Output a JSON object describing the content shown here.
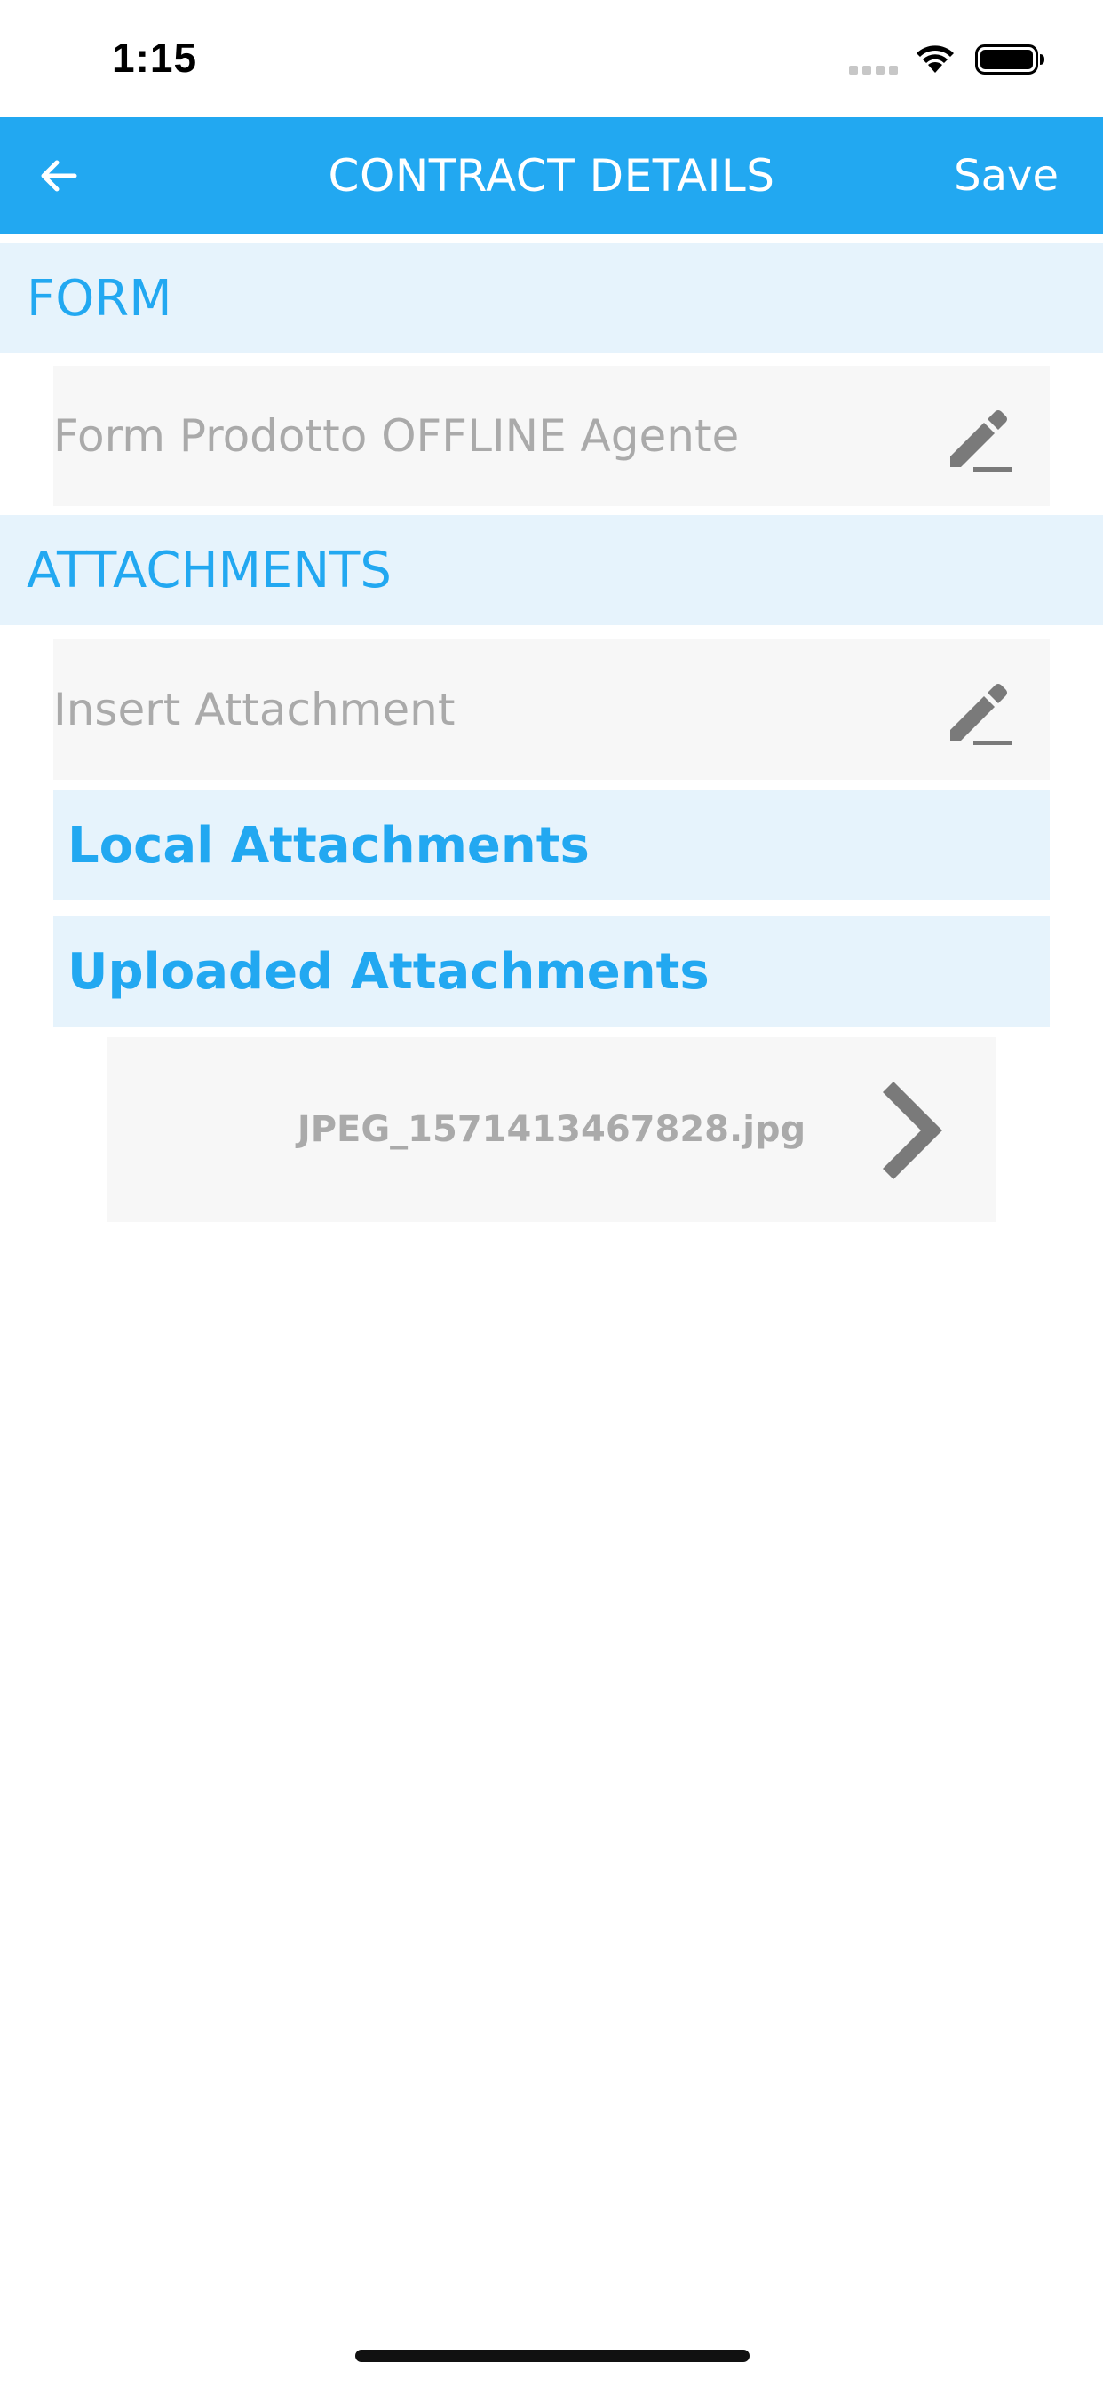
{
  "status_bar": {
    "time": "1:15"
  },
  "app_bar": {
    "title": "CONTRACT DETAILS",
    "save_label": "Save",
    "background_color": "#22a8f1",
    "back_icon": "arrow-left-icon"
  },
  "sections": {
    "form": {
      "header": "FORM",
      "field_label": "Form Prodotto OFFLINE Agente",
      "field_icon": "pencil-icon"
    },
    "attachments": {
      "header": "ATTACHMENTS",
      "insert_label": "Insert Attachment",
      "insert_icon": "pencil-icon",
      "local_header": "Local Attachments",
      "uploaded_header": "Uploaded Attachments",
      "uploaded_files": [
        {
          "name": "JPEG_1571413467828.jpg",
          "icon": "chevron-right-icon"
        }
      ]
    }
  },
  "colors": {
    "accent": "#22a8f1",
    "section_background": "#e6f3fc",
    "row_background": "#f7f7f7",
    "muted_text": "#aaaaaa",
    "icon_gray": "#7a7a7a"
  }
}
